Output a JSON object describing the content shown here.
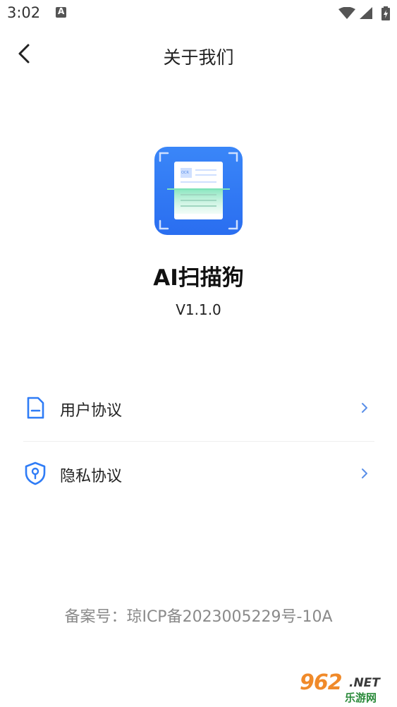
{
  "status_bar": {
    "time": "3:02",
    "icons": [
      "notification-a-icon",
      "wifi-icon",
      "signal-icon",
      "battery-icon"
    ]
  },
  "header": {
    "title": "关于我们",
    "back_icon": "chevron-left-icon"
  },
  "app": {
    "name": "AI扫描狗",
    "version": "V1.1.0",
    "icon": "document-scan-app-icon",
    "icon_text": "OCR",
    "brand_color": "#2f7cf6"
  },
  "menu": [
    {
      "label": "用户协议",
      "icon": "document-icon"
    },
    {
      "label": "隐私协议",
      "icon": "shield-lock-icon"
    }
  ],
  "footer": {
    "icp": "备案号：琼ICP备2023005229号-10A"
  },
  "watermark": {
    "main": "962",
    "domain": ".NET",
    "sub": "乐游网"
  },
  "colors": {
    "accent": "#2f7cf6",
    "chevron": "#5a8fe8",
    "footer_text": "#8a8a8a"
  }
}
